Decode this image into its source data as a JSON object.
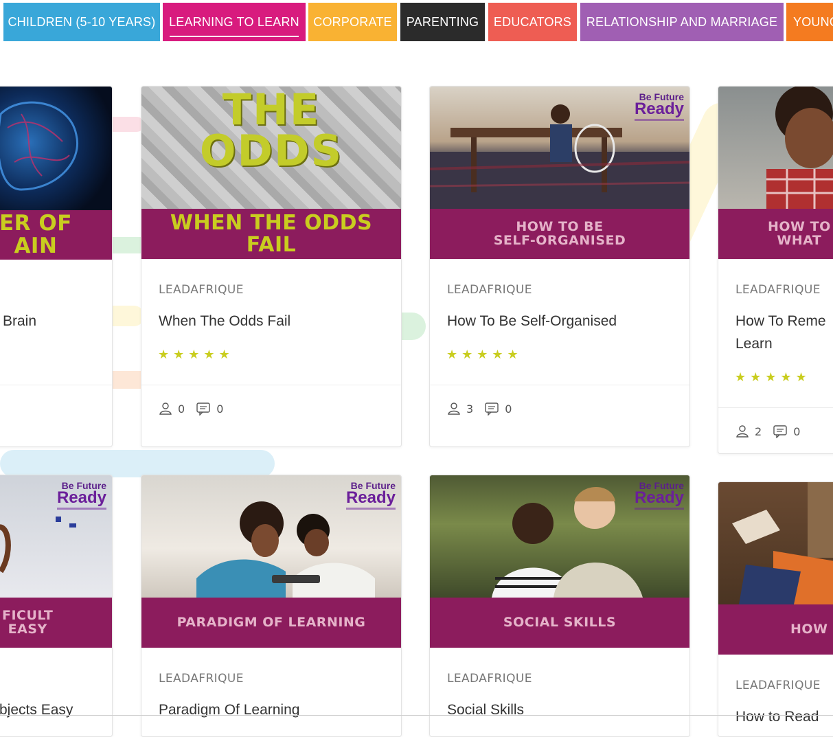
{
  "tabs": [
    {
      "label": "CHILDREN (5-10 YEARS)",
      "color": "#39a7d9",
      "active": false
    },
    {
      "label": "LEARNING TO LEARN",
      "color": "#d81b7e",
      "active": true
    },
    {
      "label": "CORPORATE",
      "color": "#f9b233",
      "active": false
    },
    {
      "label": "PARENTING",
      "color": "#2b2b2b",
      "active": false
    },
    {
      "label": "EDUCATORS",
      "color": "#ee5d53",
      "active": false
    },
    {
      "label": "RELATIONSHIP AND MARRIAGE",
      "color": "#a05fb3",
      "active": false
    },
    {
      "label": "YOUNG",
      "color": "#f47b20",
      "active": false
    }
  ],
  "brand": {
    "line1": "Be Future",
    "line2": "Ready"
  },
  "stars": "★★★★★",
  "cards": [
    {
      "band": "ER OF\nAIN",
      "org": "",
      "title": "Brain",
      "students": "",
      "comments": ""
    },
    {
      "band": "WHEN THE ODDS\nFAIL",
      "big": "THE\nODDS",
      "org": "LEADAFRIQUE",
      "title": "When The Odds Fail",
      "students": "0",
      "comments": "0"
    },
    {
      "band": "HOW TO BE\nSELF-ORGANISED",
      "org": "LEADAFRIQUE",
      "title": "How To Be Self-Organised",
      "students": "3",
      "comments": "0"
    },
    {
      "band": "HOW TO\nWHAT",
      "org": "LEADAFRIQUE",
      "title": "How To Reme\nLearn",
      "students": "2",
      "comments": "0"
    },
    {
      "band": "FICULT\nEASY",
      "org": "",
      "title": "bjects Easy"
    },
    {
      "band": "PARADIGM OF LEARNING",
      "org": "LEADAFRIQUE",
      "title": "Paradigm Of Learning"
    },
    {
      "band": "SOCIAL SKILLS",
      "org": "LEADAFRIQUE",
      "title": "Social Skills"
    },
    {
      "band": "HOW",
      "org": "LEADAFRIQUE",
      "title": "How to Read"
    }
  ],
  "colors": {
    "band": "#8c1c5d",
    "star": "#c9cd1f",
    "band_text": "#e5b3c9"
  }
}
